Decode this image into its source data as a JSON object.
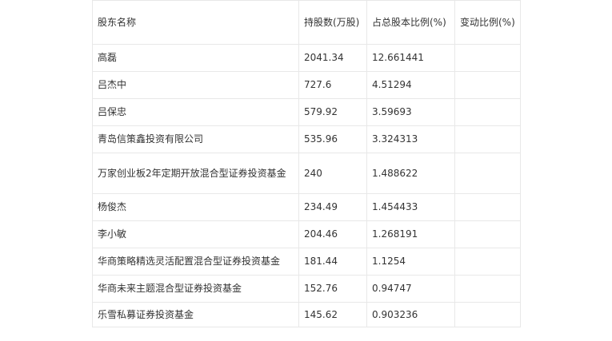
{
  "table": {
    "headers": {
      "name": "股东名称",
      "shares": "持股数(万股)",
      "ratio": "占总股本比例(%)",
      "change": "变动比例(%)"
    },
    "rows": [
      {
        "name": "高磊",
        "shares": "2041.34",
        "ratio": "12.661441",
        "change": ""
      },
      {
        "name": "吕杰中",
        "shares": "727.6",
        "ratio": "4.51294",
        "change": ""
      },
      {
        "name": "吕保忠",
        "shares": "579.92",
        "ratio": "3.59693",
        "change": ""
      },
      {
        "name": "青岛信策鑫投资有限公司",
        "shares": "535.96",
        "ratio": "3.324313",
        "change": ""
      },
      {
        "name": "万家创业板2年定期开放混合型证券投资基金",
        "shares": "240",
        "ratio": "1.488622",
        "change": ""
      },
      {
        "name": "杨俊杰",
        "shares": "234.49",
        "ratio": "1.454433",
        "change": ""
      },
      {
        "name": "李小敏",
        "shares": "204.46",
        "ratio": "1.268191",
        "change": ""
      },
      {
        "name": "华商策略精选灵活配置混合型证券投资基金",
        "shares": "181.44",
        "ratio": "1.1254",
        "change": ""
      },
      {
        "name": "华商未来主题混合型证券投资基金",
        "shares": "152.76",
        "ratio": "0.94747",
        "change": ""
      },
      {
        "name": "乐雪私募证券投资基金",
        "shares": "145.62",
        "ratio": "0.903236",
        "change": ""
      }
    ]
  }
}
